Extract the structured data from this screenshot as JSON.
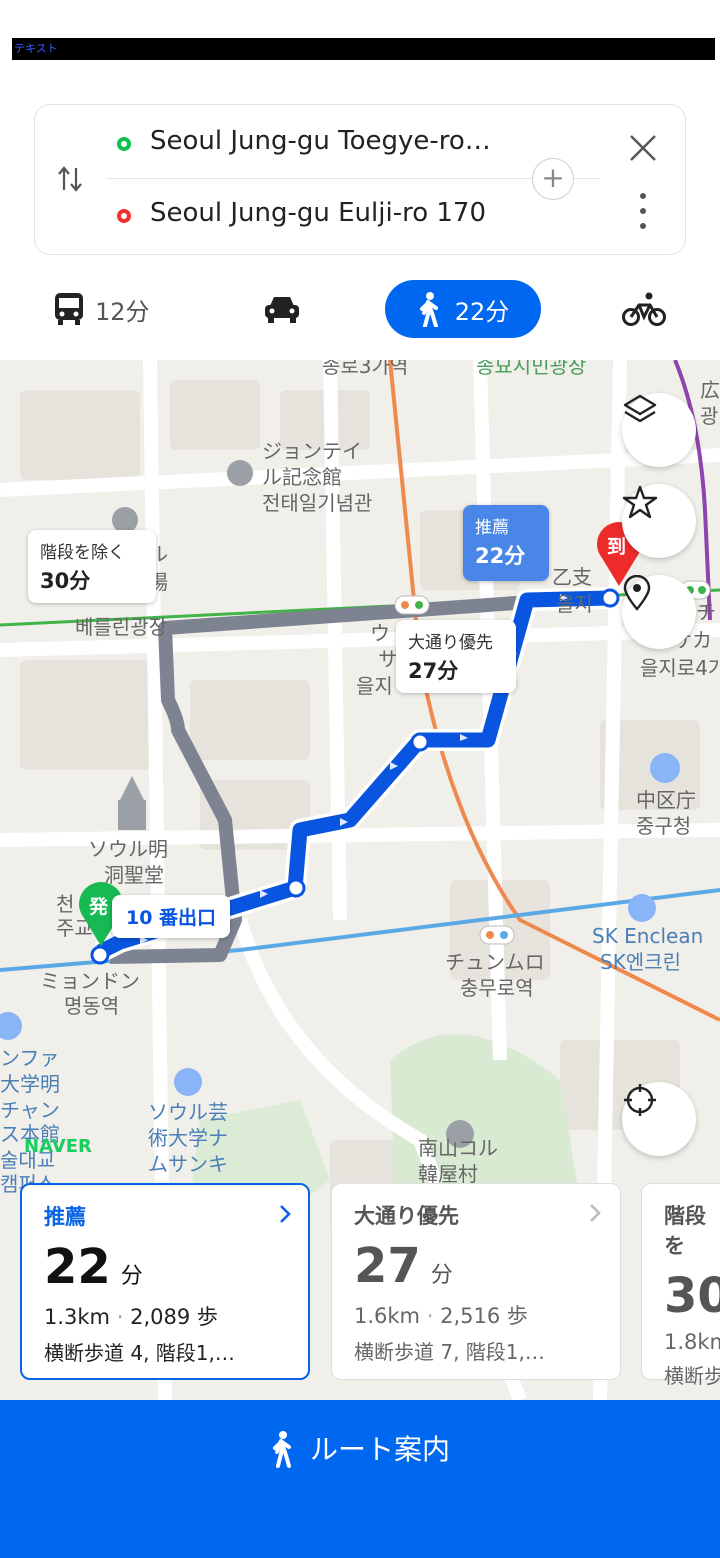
{
  "status": {
    "tag": "テキスト"
  },
  "search": {
    "origin": "Seoul Jung-gu Toegye-ro…",
    "destination": "Seoul Jung-gu Eulji-ro 170"
  },
  "modes": {
    "transit_time": "12分",
    "walk_time": "22分"
  },
  "map": {
    "labels": [
      "ジョンテイ",
      "ル記念館",
      "전태일기념관",
      "베를린광장",
      "ウ",
      "サ",
      "을지",
      "乙支",
      "을지",
      "チ",
      "サカ",
      "을지로4가",
      "中区庁",
      "중구청",
      "ソウル明",
      "洞聖堂",
      "천",
      "주교",
      "ミョンドン",
      "명동역",
      "チュンムロ",
      "충무로역",
      "SK Enclean",
      "SK엔크린",
      "ンファ",
      "大学明",
      "チャン",
      "ス本館",
      "술대교",
      "캠퍼스",
      "ソウル芸",
      "術大学ナ",
      "ムサンキ",
      "南山コル",
      "韓屋村",
      "広",
      "광",
      "종로3가역",
      "종묘시민광장",
      "ル",
      "場"
    ],
    "callouts": {
      "no_stairs_label": "階段を除く",
      "no_stairs_time": "30分",
      "recommended_label": "推薦",
      "recommended_time": "22分",
      "main_road_label": "大通り優先",
      "main_road_time": "27分"
    },
    "start_marker": "発",
    "end_marker": "到",
    "exit_label": "10 番出口",
    "brand": "NAVER"
  },
  "cards": [
    {
      "label": "推薦",
      "minutes": "22",
      "unit": "分",
      "distance": "1.3km",
      "steps": "2,089 歩",
      "details": "横断歩道 4, 階段1,…"
    },
    {
      "label": "大通り優先",
      "minutes": "27",
      "unit": "分",
      "distance": "1.6km",
      "steps": "2,516 歩",
      "details": "横断歩道 7, 階段1,…"
    },
    {
      "label": "階段を",
      "minutes": "30",
      "unit": "",
      "distance": "1.8km",
      "steps": "",
      "details": "横断歩"
    }
  ],
  "nav_button": "ルート案内",
  "colors": {
    "accent": "#0068f0",
    "route": "#0a55e0",
    "alt_route": "#7d8390"
  }
}
